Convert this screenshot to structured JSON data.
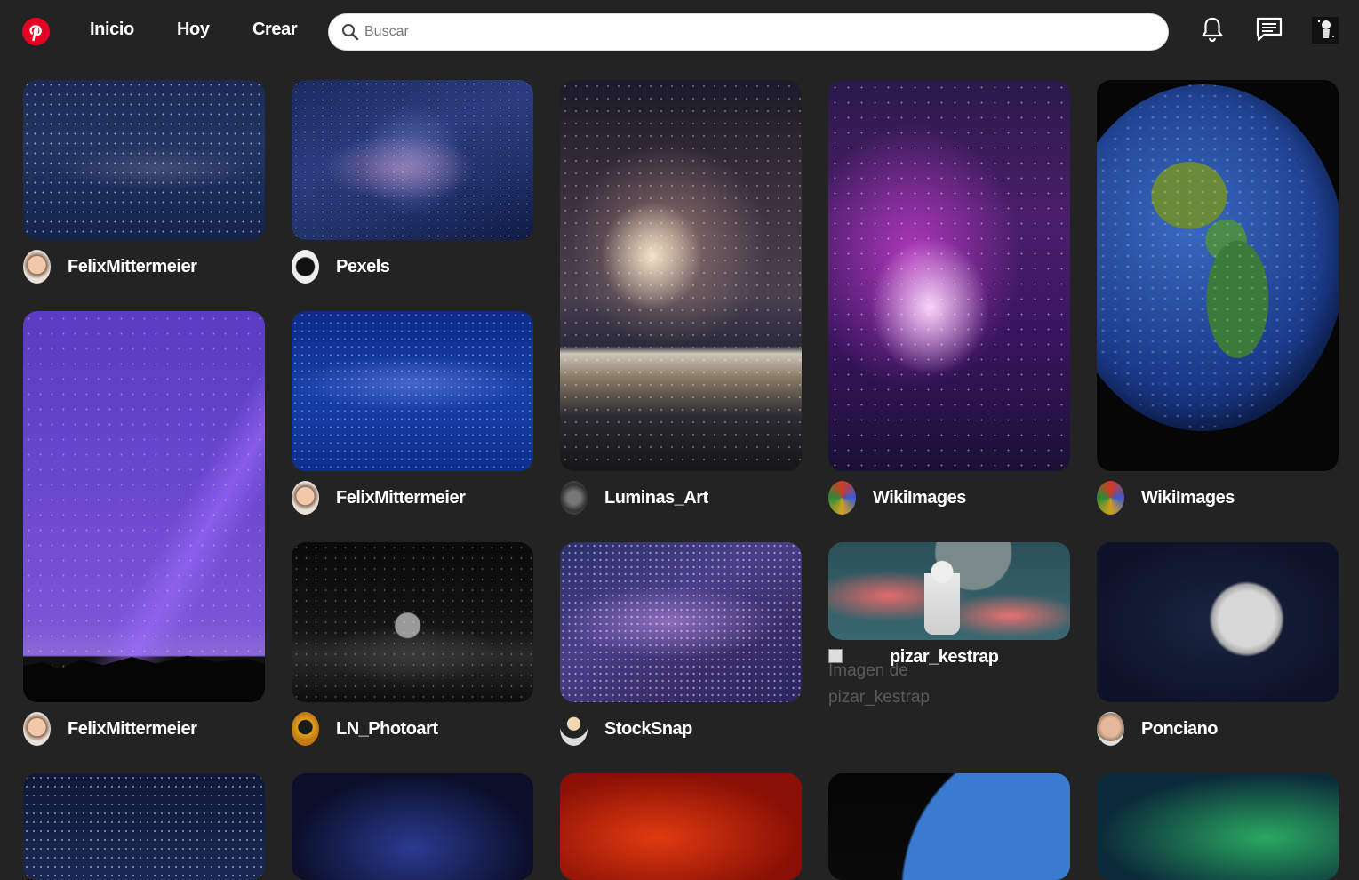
{
  "header": {
    "nav": [
      "Inicio",
      "Hoy",
      "Crear"
    ],
    "search_placeholder": "Buscar",
    "icons": [
      "pinterest-logo",
      "search-icon",
      "bell-icon",
      "chat-icon",
      "avatar"
    ]
  },
  "pins": [
    {
      "user": "FelixMittermeier",
      "subject": "starry night sky"
    },
    {
      "user": "Pexels",
      "subject": "milky way"
    },
    {
      "user": "Luminas_Art",
      "subject": "galaxy over earth horizon"
    },
    {
      "user": "WikiImages",
      "subject": "purple nebula"
    },
    {
      "user": "WikiImages",
      "subject": "planet earth"
    },
    {
      "user": "FelixMittermeier",
      "subject": "violet sky with light beam"
    },
    {
      "user": "FelixMittermeier",
      "subject": "blue milky way"
    },
    {
      "user": "LN_Photoart",
      "subject": "moon over rocky landscape"
    },
    {
      "user": "StockSnap",
      "subject": "galaxy stars"
    },
    {
      "user": "pizar_kestrap",
      "subject": "astronaut with pink clouds",
      "alt": "Imagen de pizar_kestrap"
    },
    {
      "user": "Ponciano",
      "subject": "half moon"
    }
  ],
  "colors": {
    "background": "#232323",
    "brand": "#e60023"
  }
}
